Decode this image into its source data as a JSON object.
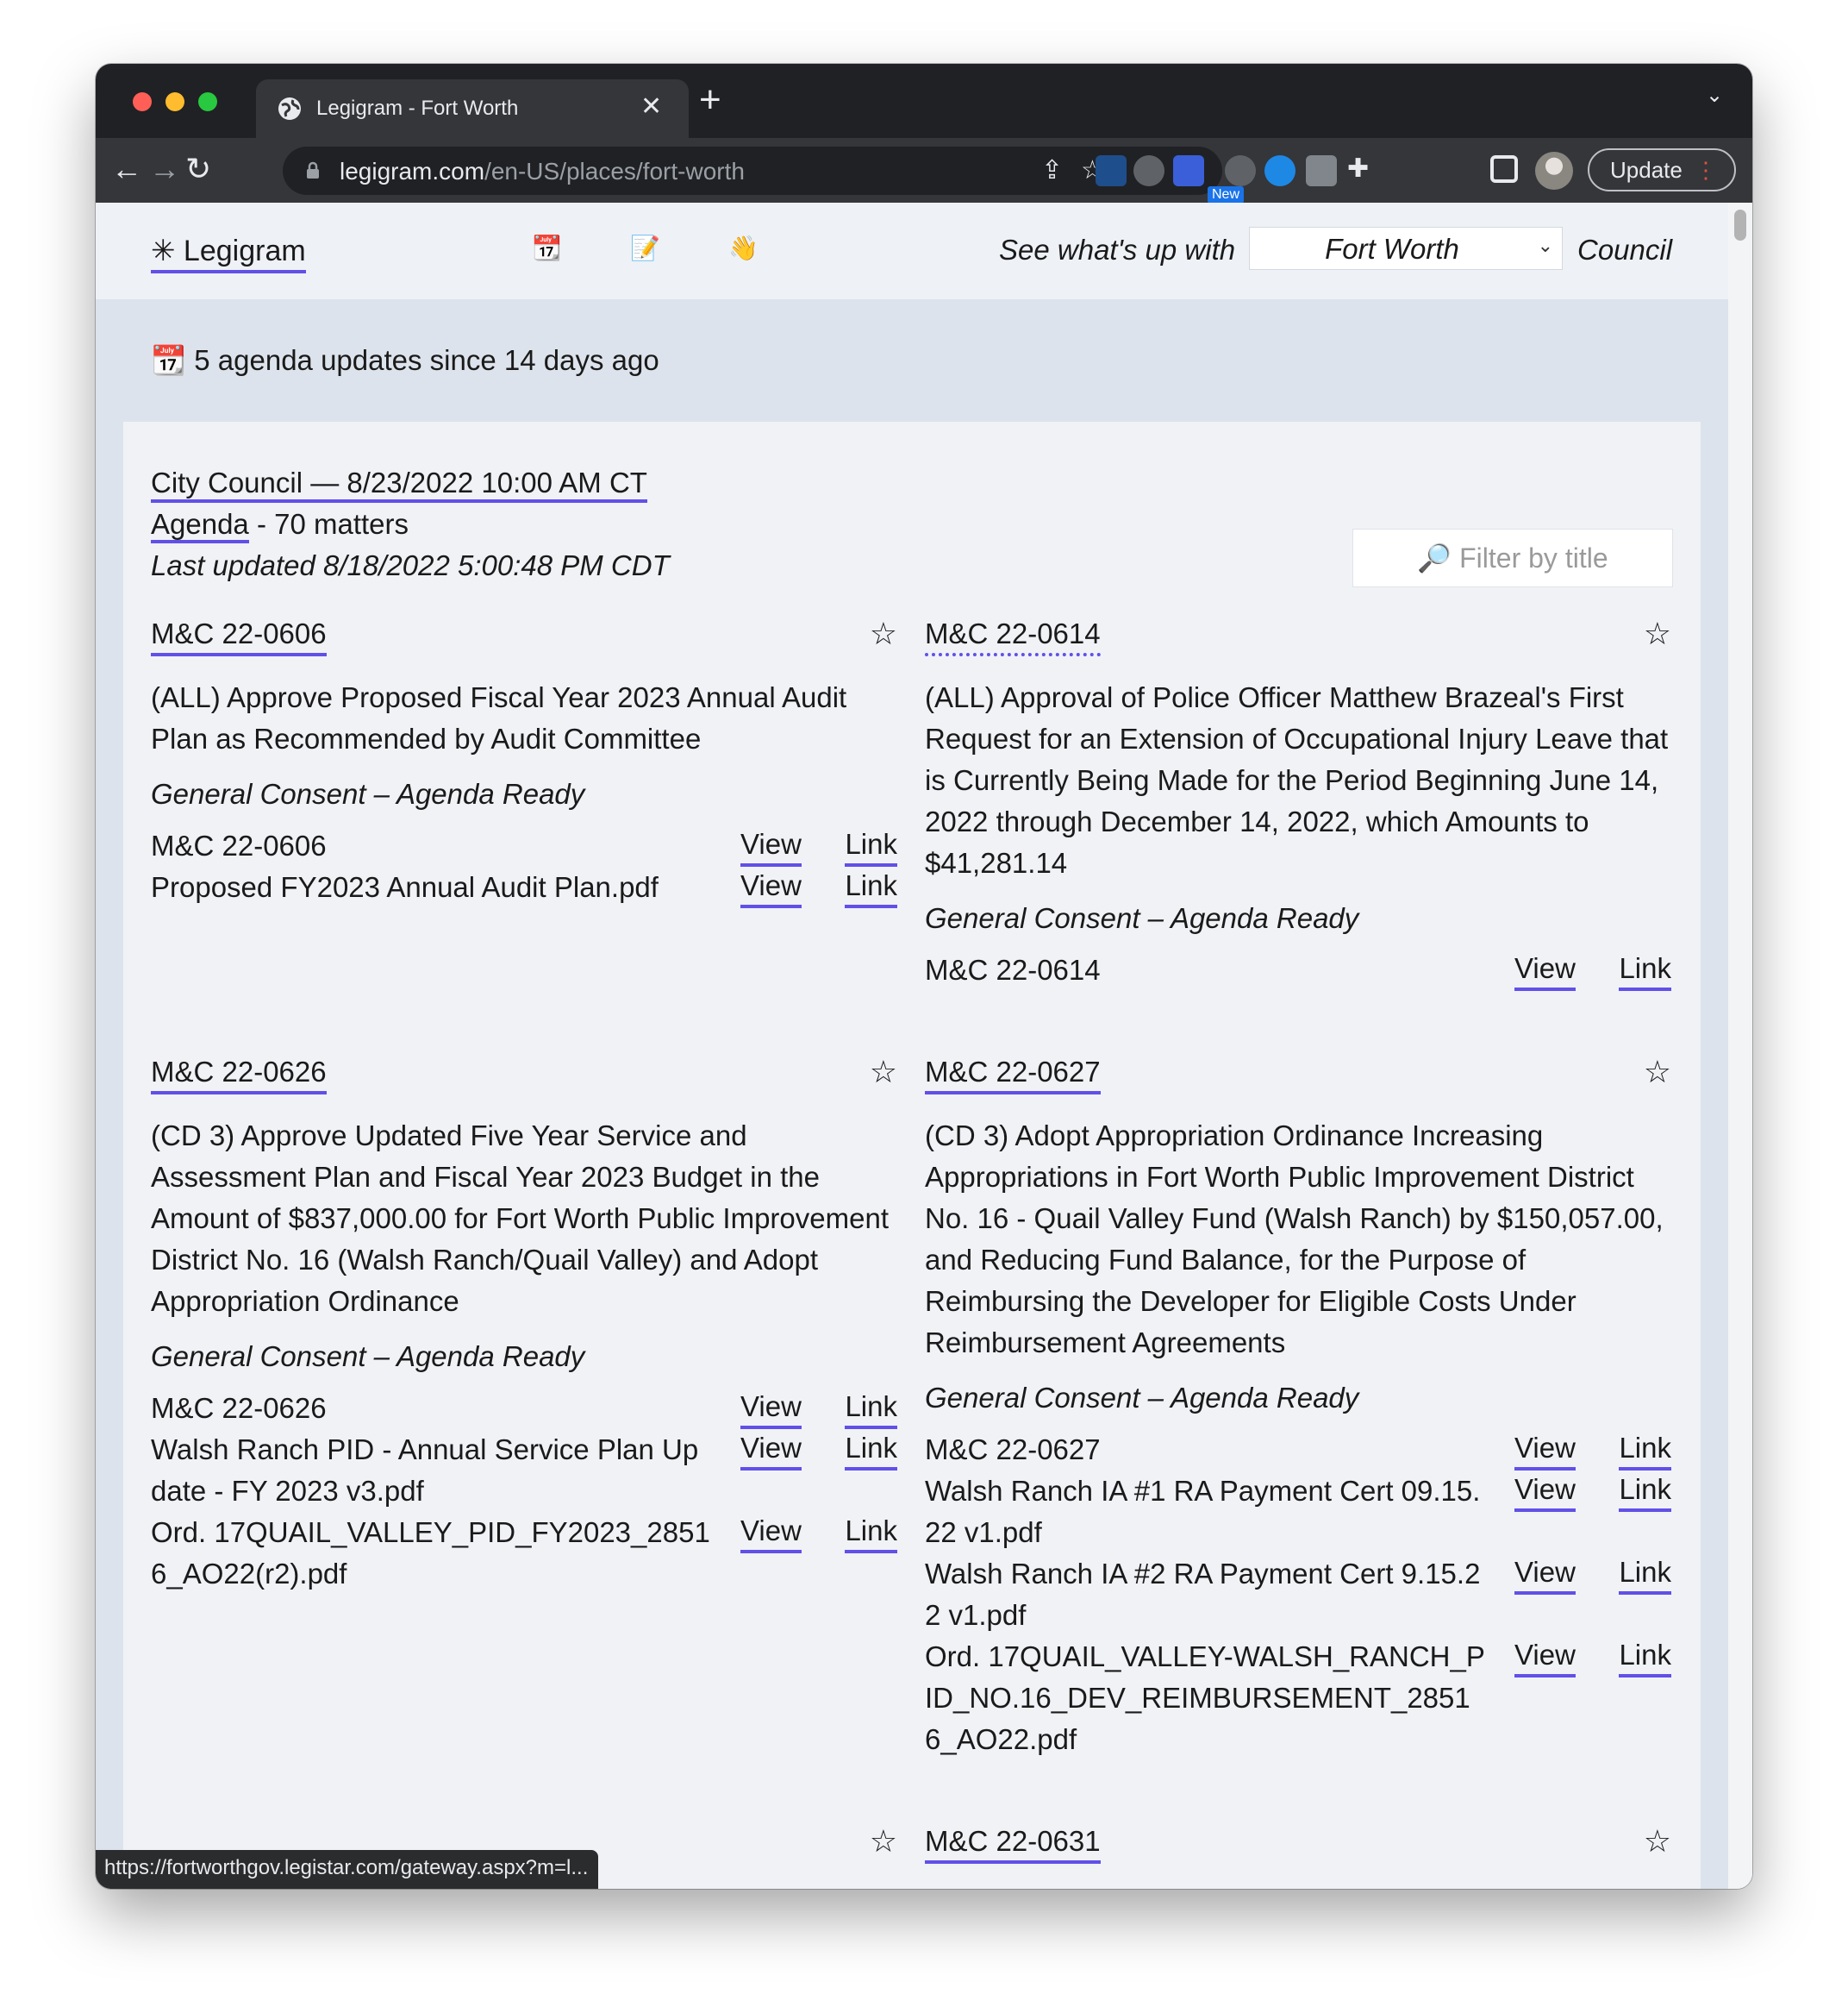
{
  "browser": {
    "tab_title": "Legigram - Fort Worth",
    "tab_close": "✕",
    "new_tab": "+",
    "url_host": "legigram.com",
    "url_path": "/en-US/places/fort-worth",
    "ext_badge": "New",
    "update_label": "Update",
    "status_url": "https://fortworthgov.legistar.com/gateway.aspx?m=l..."
  },
  "site": {
    "brand": "✳ Legigram",
    "nav_emojis": [
      "📆",
      "📝",
      "👋"
    ],
    "see_label": "See what's up with",
    "place_selected": "Fort Worth",
    "council_label": "Council",
    "updates_summary": "📆 5 agenda updates since 14 days ago"
  },
  "meeting": {
    "title": "City Council — 8/23/2022 10:00 AM CT",
    "agenda_link": "Agenda",
    "agenda_count": " - 70 matters",
    "last_updated": "Last updated 8/18/2022 5:00:48 PM CDT",
    "filter_placeholder": "🔎 Filter by title"
  },
  "items": [
    {
      "number": "M&C 22-0606",
      "description": "(ALL) Approve Proposed Fiscal Year 2023 Annual Audit Plan as Recommended by Audit Committee",
      "status": "General Consent – Agenda Ready",
      "attachments": [
        {
          "name": "M&C 22-0606",
          "view": "View",
          "link": "Link"
        },
        {
          "name": "Proposed FY2023 Annual Audit Plan.pdf",
          "view": "View",
          "link": "Link"
        }
      ]
    },
    {
      "number": "M&C 22-0614",
      "description": "(ALL) Approval of Police Officer Matthew Brazeal's First Request for an Extension of Occupational Injury Leave that is Currently Being Made for the Period Beginning June 14, 2022 through December 14, 2022, which Amounts to $41,281.14",
      "status": "General Consent – Agenda Ready",
      "attachments": [
        {
          "name": "M&C 22-0614",
          "view": "View",
          "link": "Link"
        }
      ]
    },
    {
      "number": "M&C 22-0626",
      "description": "(CD 3) Approve Updated Five Year Service and Assessment Plan and Fiscal Year 2023 Budget in the Amount of $837,000.00 for Fort Worth Public Improvement District No. 16 (Walsh Ranch/Quail Valley) and Adopt Appropriation Ordinance",
      "status": "General Consent – Agenda Ready",
      "attachments": [
        {
          "name": "M&C 22-0626",
          "view": "View",
          "link": "Link"
        },
        {
          "name": "Walsh Ranch PID - Annual Service Plan Update - FY 2023 v3.pdf",
          "view": "View",
          "link": "Link"
        },
        {
          "name": "Ord. 17QUAIL_VALLEY_PID_FY2023_28516_AO22(r2).pdf",
          "view": "View",
          "link": "Link"
        }
      ]
    },
    {
      "number": "M&C 22-0627",
      "description": "(CD 3) Adopt Appropriation Ordinance Increasing Appropriations in Fort Worth Public Improvement District No. 16 - Quail Valley Fund (Walsh Ranch) by $150,057.00, and Reducing Fund Balance, for the Purpose of Reimbursing the Developer for Eligible Costs Under Reimbursement Agreements",
      "status": "General Consent – Agenda Ready",
      "attachments": [
        {
          "name": "M&C 22-0627",
          "view": "View",
          "link": "Link"
        },
        {
          "name": "Walsh Ranch IA #1 RA Payment Cert 09.15.22 v1.pdf",
          "view": "View",
          "link": "Link"
        },
        {
          "name": "Walsh Ranch IA #2 RA Payment Cert 9.15.22 v1.pdf",
          "view": "View",
          "link": "Link"
        },
        {
          "name": "Ord. 17QUAIL_VALLEY-WALSH_RANCH_PID_NO.16_DEV_REIMBURSEMENT_28516_AO22.pdf",
          "view": "View",
          "link": "Link"
        }
      ]
    },
    {
      "number": "M&C 22-0631",
      "description": "",
      "status": "",
      "attachments": []
    }
  ],
  "star_glyph": "☆"
}
